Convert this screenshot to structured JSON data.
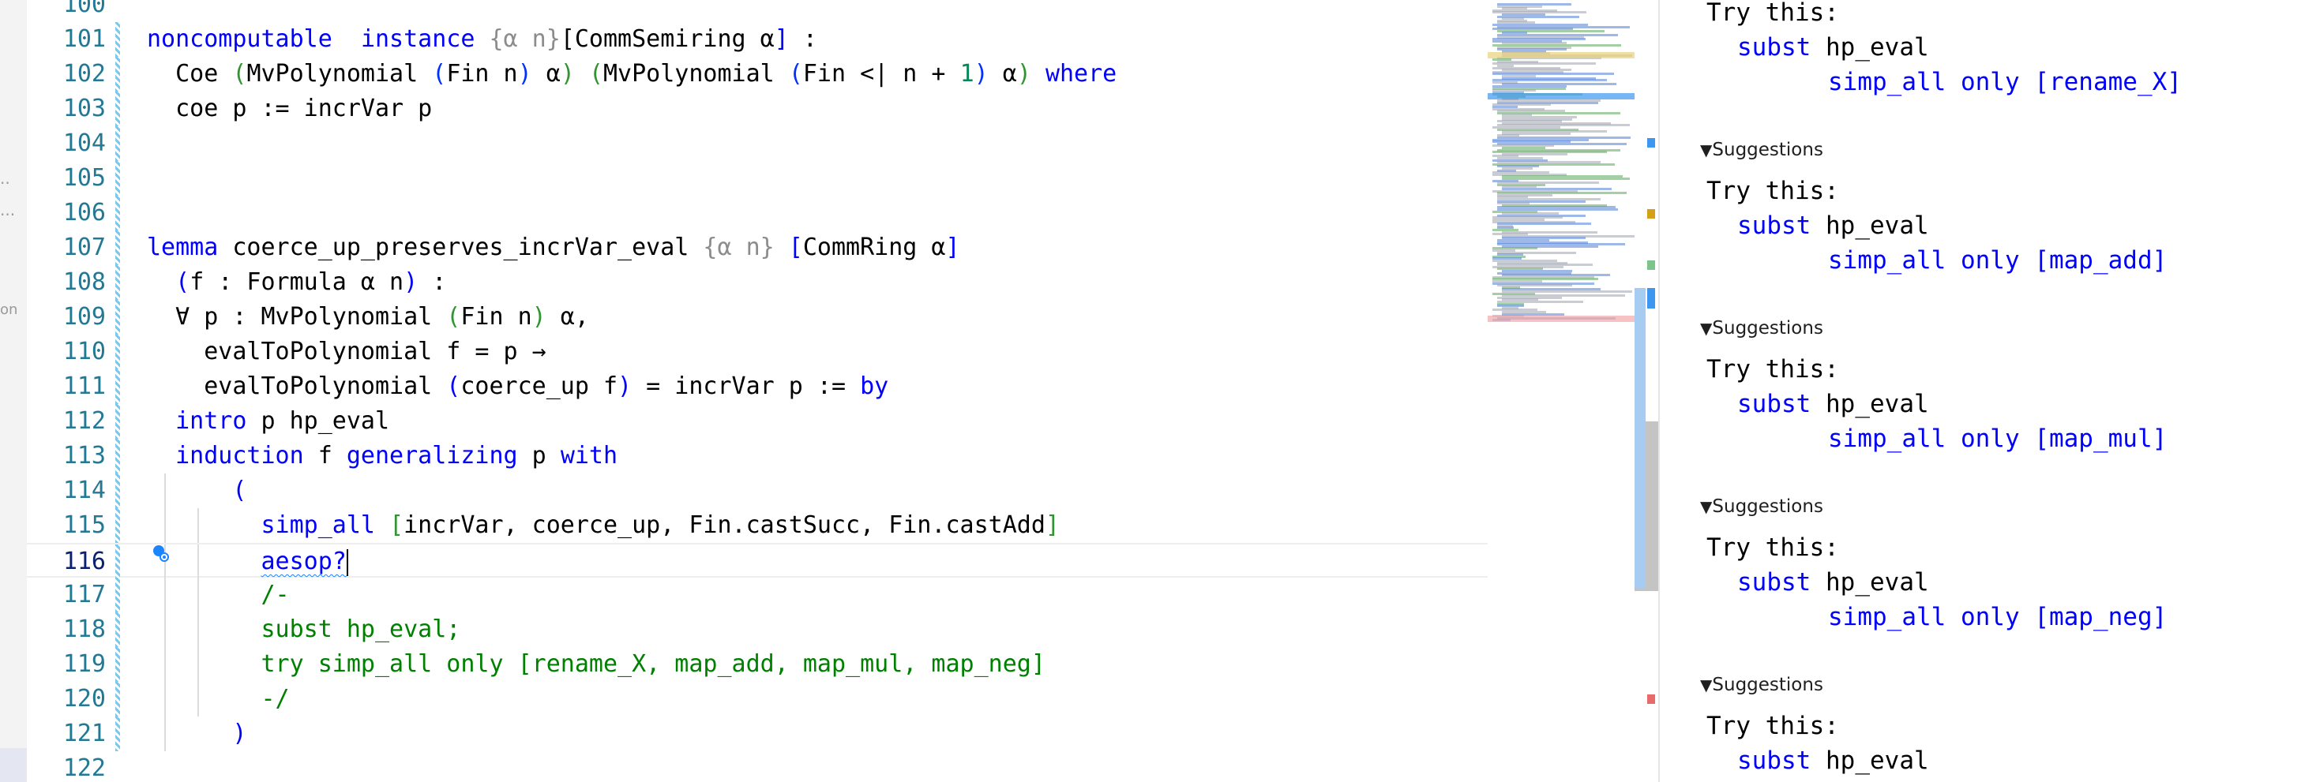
{
  "editor": {
    "lines": [
      {
        "n": "100",
        "segs": []
      },
      {
        "n": "101",
        "segs": [
          [
            "kw",
            "noncomputable"
          ],
          [
            "",
            "  "
          ],
          [
            "kw",
            "instance"
          ],
          [
            "",
            " "
          ],
          [
            "dim",
            "{α n}"
          ],
          [
            "",
            "[CommSemiring α"
          ],
          [
            "kw",
            "]"
          ],
          [
            "",
            " :"
          ]
        ]
      },
      {
        "n": "102",
        "segs": [
          [
            "",
            "  Coe "
          ],
          [
            "par",
            "("
          ],
          [
            "",
            "MvPolynomial "
          ],
          [
            "par2",
            "("
          ],
          [
            "",
            "Fin n"
          ],
          [
            "par2",
            ")"
          ],
          [
            "",
            " α"
          ],
          [
            "par",
            ")"
          ],
          [
            "",
            " "
          ],
          [
            "par",
            "("
          ],
          [
            "",
            "MvPolynomial "
          ],
          [
            "par2",
            "("
          ],
          [
            "",
            "Fin <| n + "
          ],
          [
            "num",
            "1"
          ],
          [
            "par2",
            ")"
          ],
          [
            "",
            " α"
          ],
          [
            "par",
            ")"
          ],
          [
            "",
            " "
          ],
          [
            "kw",
            "where"
          ]
        ]
      },
      {
        "n": "103",
        "segs": [
          [
            "",
            "  coe p := incrVar p"
          ]
        ]
      },
      {
        "n": "104",
        "segs": []
      },
      {
        "n": "105",
        "segs": []
      },
      {
        "n": "106",
        "segs": []
      },
      {
        "n": "107",
        "segs": [
          [
            "kw",
            "lemma"
          ],
          [
            "",
            " coerce_up_preserves_incrVar_eval "
          ],
          [
            "dim",
            "{α n}"
          ],
          [
            "",
            " "
          ],
          [
            "kw",
            "["
          ],
          [
            "",
            "CommRing α"
          ],
          [
            "kw",
            "]"
          ]
        ]
      },
      {
        "n": "108",
        "segs": [
          [
            "",
            "  "
          ],
          [
            "kw",
            "("
          ],
          [
            "",
            "f : Formula α n"
          ],
          [
            "kw",
            ")"
          ],
          [
            "",
            " :"
          ]
        ]
      },
      {
        "n": "109",
        "segs": [
          [
            "",
            "  ∀ p : MvPolynomial "
          ],
          [
            "par",
            "("
          ],
          [
            "",
            "Fin n"
          ],
          [
            "par",
            ")"
          ],
          [
            "",
            " α,"
          ]
        ]
      },
      {
        "n": "110",
        "segs": [
          [
            "",
            "    evalToPolynomial f = p →"
          ]
        ]
      },
      {
        "n": "111",
        "segs": [
          [
            "",
            "    evalToPolynomial "
          ],
          [
            "kw",
            "("
          ],
          [
            "",
            "coerce_up f"
          ],
          [
            "kw",
            ")"
          ],
          [
            "",
            " = incrVar p := "
          ],
          [
            "kw",
            "by"
          ]
        ]
      },
      {
        "n": "112",
        "segs": [
          [
            "",
            "  "
          ],
          [
            "kw",
            "intro"
          ],
          [
            "",
            " p hp_eval"
          ]
        ]
      },
      {
        "n": "113",
        "segs": [
          [
            "",
            "  "
          ],
          [
            "kw",
            "induction"
          ],
          [
            "",
            " f "
          ],
          [
            "kw",
            "generalizing"
          ],
          [
            "",
            " p "
          ],
          [
            "kw",
            "with"
          ]
        ]
      },
      {
        "n": "114",
        "segs": [
          [
            "",
            "      "
          ],
          [
            "kw",
            "("
          ]
        ]
      },
      {
        "n": "115",
        "segs": [
          [
            "",
            "        "
          ],
          [
            "tac",
            "simp_all"
          ],
          [
            "",
            " "
          ],
          [
            "par",
            "["
          ],
          [
            "",
            "incrVar, coerce_up, Fin.castSucc, Fin.castAdd"
          ],
          [
            "par",
            "]"
          ],
          [
            ";"
          ]
        ]
      },
      {
        "n": "116",
        "segs": [
          [
            "",
            "        "
          ],
          [
            "tac squig",
            "aesop?"
          ]
        ]
      },
      {
        "n": "117",
        "segs": [
          [
            "cmt",
            "        /-"
          ]
        ]
      },
      {
        "n": "118",
        "segs": [
          [
            "cmt",
            "        subst hp_eval;"
          ]
        ]
      },
      {
        "n": "119",
        "segs": [
          [
            "cmt",
            "        try simp_all only [rename_X, map_add, map_mul, map_neg]"
          ]
        ]
      },
      {
        "n": "120",
        "segs": [
          [
            "cmt",
            "        -/"
          ]
        ]
      },
      {
        "n": "121",
        "segs": [
          [
            "",
            "      "
          ],
          [
            "kw",
            ")"
          ]
        ]
      },
      {
        "n": "122",
        "segs": []
      }
    ],
    "current_line": "116"
  },
  "infoview": {
    "try_this": "Try this:",
    "suggestions_label": "Suggestions",
    "subst": "subst",
    "hp": "hp_eval",
    "simp_all": "simp_all",
    "only": "only",
    "blocks": [
      {
        "lemma": "[rename_X]"
      },
      {
        "lemma": "[map_add]"
      },
      {
        "lemma": "[map_mul]"
      },
      {
        "lemma": "[map_neg]"
      },
      {
        "lemma": ""
      }
    ]
  },
  "colors": {
    "keyword": "#0000ff",
    "line_number": "#237893",
    "comment": "#008000",
    "bracket_green": "#319331",
    "number": "#098658"
  },
  "icons": {
    "lightbulb": "lightbulb-autofix-icon",
    "collapse": "triangle-down-icon"
  }
}
